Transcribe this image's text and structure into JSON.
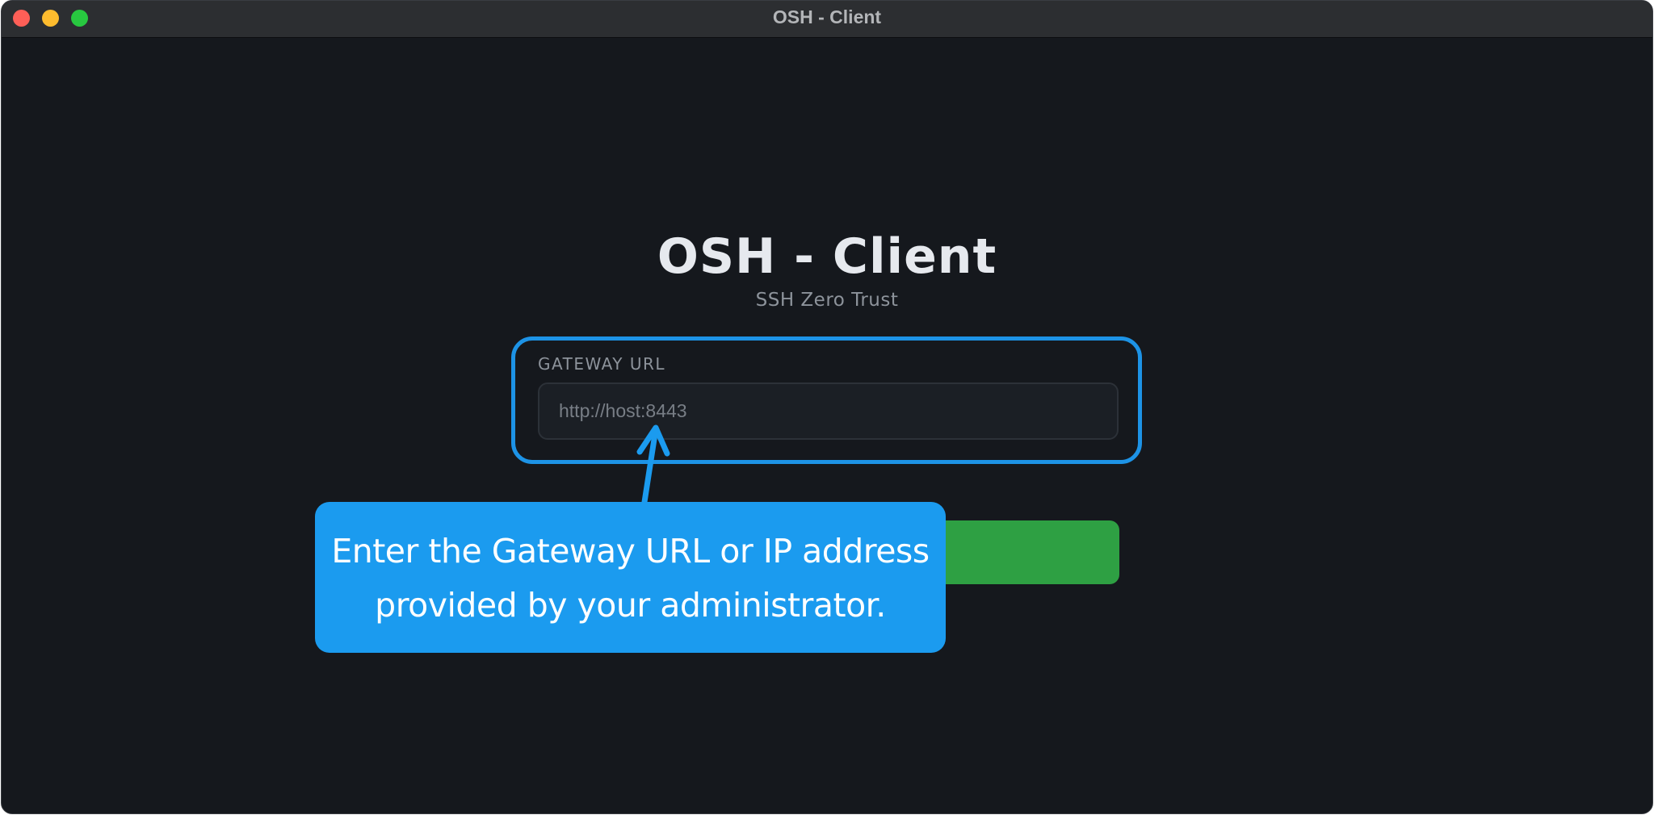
{
  "window": {
    "title": "OSH - Client"
  },
  "app": {
    "title": "OSH - Client",
    "subtitle": "SSH Zero Trust"
  },
  "gateway": {
    "label": "GATEWAY URL",
    "placeholder": "http://host:8443",
    "value": ""
  },
  "callout": {
    "line1": "Enter the Gateway URL or IP address",
    "line2": "provided by your administrator."
  },
  "colors": {
    "highlight": "#1d93e6",
    "callout_bg": "#1b9bef",
    "button_bg": "#2ea043",
    "window_bg": "#15181d"
  }
}
